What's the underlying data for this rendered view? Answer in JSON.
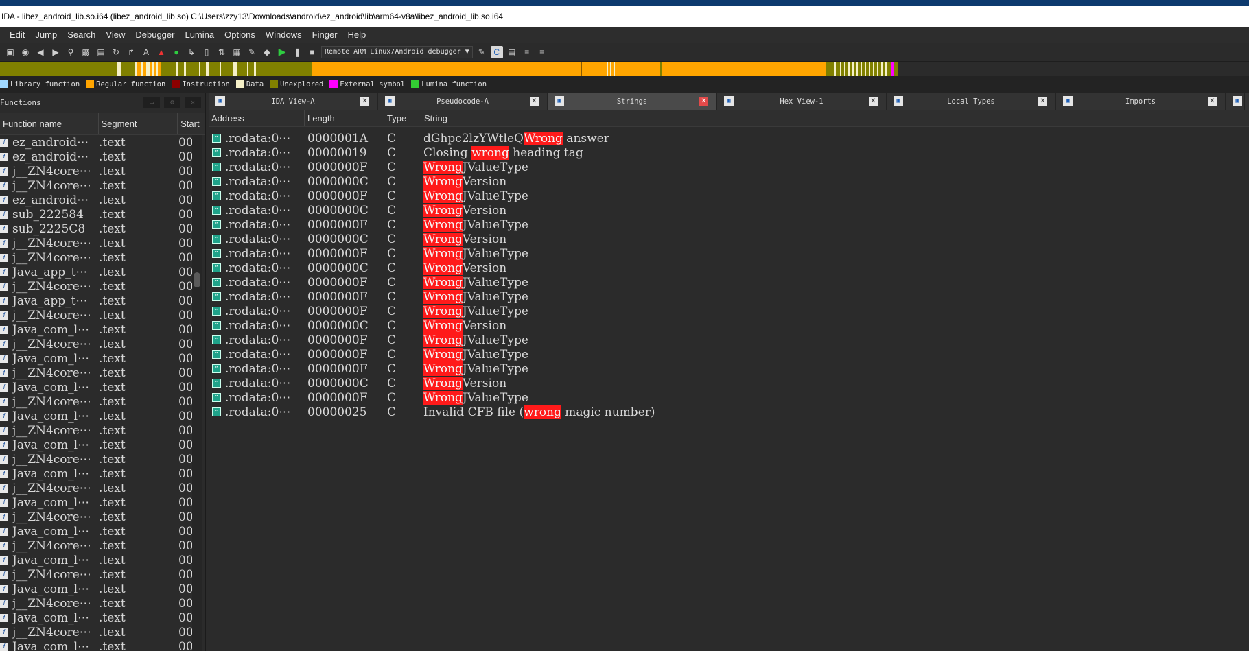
{
  "window": {
    "title": "IDA - libez_android_lib.so.i64 (libez_android_lib.so) C:\\Users\\zzy13\\Downloads\\android\\ez_android\\lib\\arm64-v8a\\libez_android_lib.so.i64"
  },
  "menu": [
    "Edit",
    "Jump",
    "Search",
    "View",
    "Debugger",
    "Lumina",
    "Options",
    "Windows",
    "Finger",
    "Help"
  ],
  "toolbar": {
    "debugger_select": "Remote ARM Linux/Android debugger",
    "icons": [
      "save-icon",
      "disk-icon",
      "back-icon",
      "forward-icon",
      "search-icon",
      "binary-icon",
      "text-search-icon",
      "next-icon",
      "up-icon",
      "A-icon",
      "red-icon",
      "green-icon",
      "func-icon",
      "segment-icon",
      "refresh-icon",
      "graph-icon",
      "struct-icon",
      "enum-icon",
      "play-icon",
      "pause-icon",
      "stop-icon"
    ]
  },
  "legend": [
    {
      "label": "Library function",
      "color": "#a0d8ff"
    },
    {
      "label": "Regular function",
      "color": "#ffa500"
    },
    {
      "label": "Instruction",
      "color": "#8b0000"
    },
    {
      "label": "Data",
      "color": "#f5f0c8"
    },
    {
      "label": "Unexplored",
      "color": "#808000"
    },
    {
      "label": "External symbol",
      "color": "#ff00ff"
    },
    {
      "label": "Lumina function",
      "color": "#33cc33"
    }
  ],
  "functions_panel": {
    "title": "Functions",
    "columns": [
      "Function name",
      "Segment",
      "Start"
    ],
    "rows": [
      [
        "ez_android⋯",
        ".text",
        "00"
      ],
      [
        "ez_android⋯",
        ".text",
        "00"
      ],
      [
        "j__ZN4core⋯",
        ".text",
        "00"
      ],
      [
        "j__ZN4core⋯",
        ".text",
        "00"
      ],
      [
        "ez_android⋯",
        ".text",
        "00"
      ],
      [
        "sub_222584",
        ".text",
        "00"
      ],
      [
        "sub_2225C8",
        ".text",
        "00"
      ],
      [
        "j__ZN4core⋯",
        ".text",
        "00"
      ],
      [
        "j__ZN4core⋯",
        ".text",
        "00"
      ],
      [
        "Java_app_t⋯",
        ".text",
        "00"
      ],
      [
        "j__ZN4core⋯",
        ".text",
        "00"
      ],
      [
        "Java_app_t⋯",
        ".text",
        "00"
      ],
      [
        "j__ZN4core⋯",
        ".text",
        "00"
      ],
      [
        "Java_com_l⋯",
        ".text",
        "00"
      ],
      [
        "j__ZN4core⋯",
        ".text",
        "00"
      ],
      [
        "Java_com_l⋯",
        ".text",
        "00"
      ],
      [
        "j__ZN4core⋯",
        ".text",
        "00"
      ],
      [
        "Java_com_l⋯",
        ".text",
        "00"
      ],
      [
        "j__ZN4core⋯",
        ".text",
        "00"
      ],
      [
        "Java_com_l⋯",
        ".text",
        "00"
      ],
      [
        "j__ZN4core⋯",
        ".text",
        "00"
      ],
      [
        "Java_com_l⋯",
        ".text",
        "00"
      ],
      [
        "j__ZN4core⋯",
        ".text",
        "00"
      ],
      [
        "Java_com_l⋯",
        ".text",
        "00"
      ],
      [
        "j__ZN4core⋯",
        ".text",
        "00"
      ],
      [
        "Java_com_l⋯",
        ".text",
        "00"
      ],
      [
        "j__ZN4core⋯",
        ".text",
        "00"
      ],
      [
        "Java_com_l⋯",
        ".text",
        "00"
      ],
      [
        "j__ZN4core⋯",
        ".text",
        "00"
      ],
      [
        "Java_com_l⋯",
        ".text",
        "00"
      ],
      [
        "j__ZN4core⋯",
        ".text",
        "00"
      ],
      [
        "Java_com_l⋯",
        ".text",
        "00"
      ],
      [
        "j__ZN4core⋯",
        ".text",
        "00"
      ],
      [
        "Java_com_l⋯",
        ".text",
        "00"
      ],
      [
        "j__ZN4core⋯",
        ".text",
        "00"
      ],
      [
        "Java_com_l⋯",
        ".text",
        "00"
      ]
    ]
  },
  "tabs": [
    {
      "label": "IDA View-A",
      "active": false
    },
    {
      "label": "Pseudocode-A",
      "active": false
    },
    {
      "label": "Strings",
      "active": true
    },
    {
      "label": "Hex View-1",
      "active": false
    },
    {
      "label": "Local Types",
      "active": false
    },
    {
      "label": "Imports",
      "active": false
    }
  ],
  "strings_panel": {
    "columns": [
      "Address",
      "Length",
      "Type",
      "String"
    ],
    "rows": [
      {
        "address": ".rodata:0⋯",
        "length": "0000001A",
        "type": "C",
        "pre": "dGhpc2lzYWtleQ",
        "match": "Wrong",
        "post": " answer"
      },
      {
        "address": ".rodata:0⋯",
        "length": "00000019",
        "type": "C",
        "pre": "Closing ",
        "match": "wrong",
        "post": " heading tag"
      },
      {
        "address": ".rodata:0⋯",
        "length": "0000000F",
        "type": "C",
        "pre": "",
        "match": "Wrong",
        "post": "JValueType"
      },
      {
        "address": ".rodata:0⋯",
        "length": "0000000C",
        "type": "C",
        "pre": "",
        "match": "Wrong",
        "post": "Version"
      },
      {
        "address": ".rodata:0⋯",
        "length": "0000000F",
        "type": "C",
        "pre": "",
        "match": "Wrong",
        "post": "JValueType"
      },
      {
        "address": ".rodata:0⋯",
        "length": "0000000C",
        "type": "C",
        "pre": "",
        "match": "Wrong",
        "post": "Version"
      },
      {
        "address": ".rodata:0⋯",
        "length": "0000000F",
        "type": "C",
        "pre": "",
        "match": "Wrong",
        "post": "JValueType"
      },
      {
        "address": ".rodata:0⋯",
        "length": "0000000C",
        "type": "C",
        "pre": "",
        "match": "Wrong",
        "post": "Version"
      },
      {
        "address": ".rodata:0⋯",
        "length": "0000000F",
        "type": "C",
        "pre": "",
        "match": "Wrong",
        "post": "JValueType"
      },
      {
        "address": ".rodata:0⋯",
        "length": "0000000C",
        "type": "C",
        "pre": "",
        "match": "Wrong",
        "post": "Version"
      },
      {
        "address": ".rodata:0⋯",
        "length": "0000000F",
        "type": "C",
        "pre": "",
        "match": "Wrong",
        "post": "JValueType"
      },
      {
        "address": ".rodata:0⋯",
        "length": "0000000F",
        "type": "C",
        "pre": "",
        "match": "Wrong",
        "post": "JValueType"
      },
      {
        "address": ".rodata:0⋯",
        "length": "0000000F",
        "type": "C",
        "pre": "",
        "match": "Wrong",
        "post": "JValueType"
      },
      {
        "address": ".rodata:0⋯",
        "length": "0000000C",
        "type": "C",
        "pre": "",
        "match": "Wrong",
        "post": "Version"
      },
      {
        "address": ".rodata:0⋯",
        "length": "0000000F",
        "type": "C",
        "pre": "",
        "match": "Wrong",
        "post": "JValueType"
      },
      {
        "address": ".rodata:0⋯",
        "length": "0000000F",
        "type": "C",
        "pre": "",
        "match": "Wrong",
        "post": "JValueType"
      },
      {
        "address": ".rodata:0⋯",
        "length": "0000000F",
        "type": "C",
        "pre": "",
        "match": "Wrong",
        "post": "JValueType"
      },
      {
        "address": ".rodata:0⋯",
        "length": "0000000C",
        "type": "C",
        "pre": "",
        "match": "Wrong",
        "post": "Version"
      },
      {
        "address": ".rodata:0⋯",
        "length": "0000000F",
        "type": "C",
        "pre": "",
        "match": "Wrong",
        "post": "JValueType"
      },
      {
        "address": ".rodata:0⋯",
        "length": "00000025",
        "type": "C",
        "pre": "Invalid CFB file (",
        "match": "wrong",
        "post": " magic number)"
      }
    ]
  },
  "colors": {
    "highlight": "#ff1a1a",
    "background": "#2b2b2b",
    "nav_regular": "#ffa500",
    "nav_unexplored": "#808000"
  }
}
